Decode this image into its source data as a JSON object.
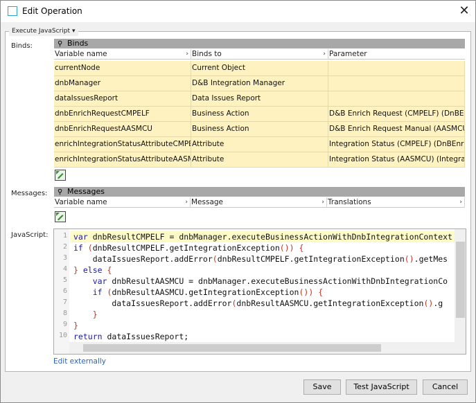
{
  "window": {
    "title": "Edit Operation",
    "app_icon": "square-window-icon",
    "close_icon": "close-icon"
  },
  "section": {
    "legend": "Execute JavaScript",
    "caret": "▾"
  },
  "labels": {
    "binds": "Binds:",
    "messages": "Messages:",
    "javascript": "JavaScript:"
  },
  "binds_table": {
    "title": "Binds",
    "columns": [
      "Variable name",
      "Binds to",
      "Parameter"
    ],
    "rows": [
      [
        "currentNode",
        "Current Object",
        ""
      ],
      [
        "dnbManager",
        "D&B Integration Manager",
        ""
      ],
      [
        "dataIssuesReport",
        "Data Issues Report",
        ""
      ],
      [
        "dnbEnrichRequestCMPELF",
        "Business Action",
        "D&B Enrich Request (CMPELF) (DnBEn…"
      ],
      [
        "dnbEnrichRequestAASMCU",
        "Business Action",
        "D&B Enrich Request Manual (AASMCU)…"
      ],
      [
        "enrichIntegrationStatusAttributeCMPELF",
        "Attribute",
        "Integration Status (CMPELF) (DnBEnri…"
      ],
      [
        "enrichIntegrationStatusAttributeAASM…",
        "Attribute",
        "Integration Status (AASMCU) (Integra…"
      ]
    ],
    "add_icon": "add-row-icon"
  },
  "messages_table": {
    "title": "Messages",
    "columns": [
      "Variable name",
      "Message",
      "Translations"
    ],
    "add_icon": "add-row-icon"
  },
  "editor": {
    "line_numbers": [
      "1",
      "2",
      "3",
      "4",
      "5",
      "6",
      "7",
      "8",
      "9",
      "10"
    ],
    "lines": [
      "var dnbResultCMPELF = dnbManager.executeBusinessActionWithDnbIntegrationContext",
      "if (dnbResultCMPELF.getIntegrationException()) {",
      "    dataIssuesReport.addError(dnbResultCMPELF.getIntegrationException().getMes",
      "} else {",
      "    var dnbResultAASMCU = dnbManager.executeBusinessActionWithDnbIntegrationCo",
      "    if (dnbResultAASMCU.getIntegrationException()) {",
      "        dataIssuesReport.addError(dnbResultAASMCU.getIntegrationException().g",
      "    }",
      "}",
      "return dataIssuesReport;"
    ]
  },
  "edit_externally": "Edit externally",
  "buttons": {
    "save": "Save",
    "test": "Test JavaScript",
    "cancel": "Cancel"
  }
}
